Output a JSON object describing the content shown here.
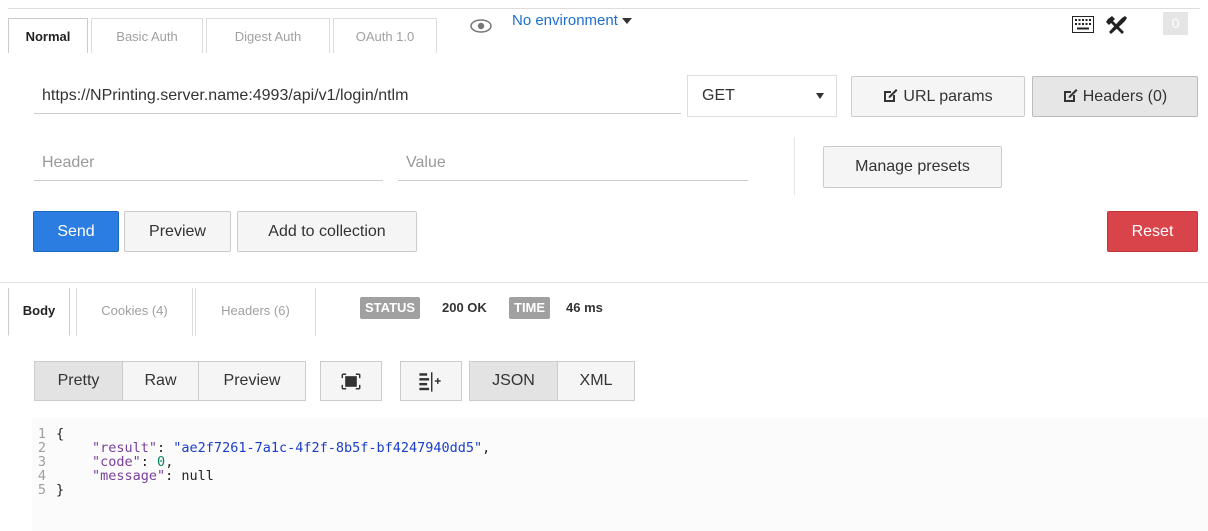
{
  "auth_tabs": [
    "Normal",
    "Basic Auth",
    "Digest Auth",
    "OAuth 1.0"
  ],
  "environment": {
    "label": "No environment"
  },
  "toolbar": {
    "count": "0",
    "icons": [
      "keyboard-icon",
      "wrench-icon",
      "eye-icon"
    ]
  },
  "request": {
    "url": "https://NPrinting.server.name:4993/api/v1/login/ntlm",
    "method": "GET",
    "url_params_label": "URL params",
    "headers_label": "Headers (0)",
    "header_placeholder": "Header",
    "value_placeholder": "Value",
    "manage_presets_label": "Manage presets"
  },
  "actions": {
    "send": "Send",
    "preview": "Preview",
    "add_to_collection": "Add to collection",
    "reset": "Reset"
  },
  "response_tabs": [
    "Body",
    "Cookies (4)",
    "Headers (6)"
  ],
  "status": {
    "status_label": "STATUS",
    "status_value": "200 OK",
    "time_label": "TIME",
    "time_value": "46 ms"
  },
  "view_modes": [
    "Pretty",
    "Raw",
    "Preview"
  ],
  "formats": [
    "JSON",
    "XML"
  ],
  "body": {
    "line_numbers": [
      "1",
      "2",
      "3",
      "4",
      "5"
    ],
    "open_brace": "{",
    "close_brace": "}",
    "result_key": "\"result\"",
    "result_value": "\"ae2f7261-7a1c-4f2f-8b5f-bf4247940dd5\"",
    "code_key": "\"code\"",
    "code_value": "0",
    "message_key": "\"message\"",
    "message_value": "null"
  },
  "colors": {
    "send": "#2b7de1",
    "reset": "#d9444a",
    "env_link": "#1c6fd1",
    "badge": "#a0a0a0"
  }
}
